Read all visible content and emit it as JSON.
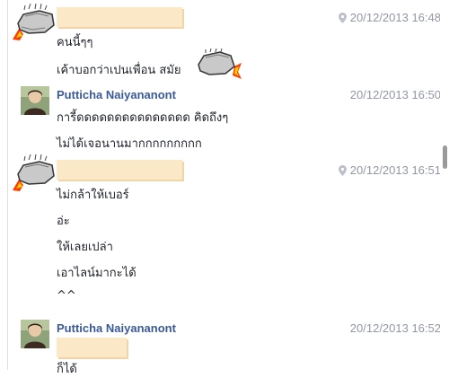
{
  "scrollbar": {
    "visible": true
  },
  "messages": [
    {
      "time": "20/12/2013 16:48",
      "lines": [
        "คนนี้ๆๆ",
        "เค้าบอกว่าเปนเพื่อน สมัย"
      ]
    },
    {
      "sender": "Putticha Naiyananont",
      "time": "20/12/2013 16:50",
      "lines": [
        "การี้ดดดดดดดดดดดดดดด คิดถึงๆ",
        "ไม่ได้เจอนานมากกกกกกกกก"
      ]
    },
    {
      "time": "20/12/2013 16:51",
      "lines": [
        "ไม่กล้าให้เบอร์",
        "อ่ะ",
        "ให้เลยเปล่า",
        "เอาไลน์มากะได้",
        "^^"
      ]
    },
    {
      "sender": "Putticha Naiyananont",
      "time": "20/12/2013 16:52",
      "lines": [
        "ก็ได้"
      ]
    }
  ],
  "icons": {
    "rock": "rock-sticker-icon",
    "pin": "location-pin-icon",
    "avatar": "profile-photo"
  },
  "colors": {
    "sender_name": "#3b5998",
    "timestamp": "#9197a3",
    "censor_box": "#fbe8c6"
  }
}
